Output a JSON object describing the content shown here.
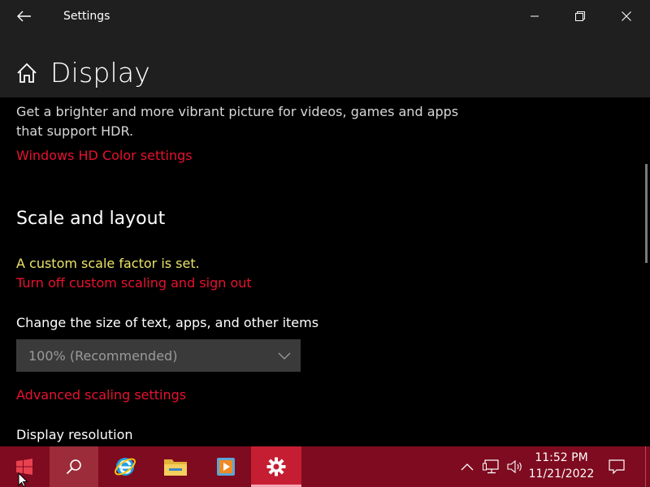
{
  "window": {
    "title": "Settings"
  },
  "page": {
    "title": "Display"
  },
  "hdr": {
    "description": "Get a brighter and more vibrant picture for videos, games and apps that support HDR.",
    "link": "Windows HD Color settings"
  },
  "scale": {
    "section_title": "Scale and layout",
    "warning": "A custom scale factor is set.",
    "signout_link": "Turn off custom scaling and sign out",
    "size_label": "Change the size of text, apps, and other items",
    "size_value": "100% (Recommended)",
    "advanced_link": "Advanced scaling settings",
    "resolution_label": "Display resolution"
  },
  "taskbar": {
    "time": "11:52 PM",
    "date": "11/21/2022",
    "icons": [
      "windows-start-icon",
      "search-icon",
      "internet-explorer-icon",
      "file-explorer-icon",
      "media-player-icon",
      "settings-gear-icon"
    ]
  },
  "colors": {
    "accent_link": "#e81130",
    "warning": "#ece56a",
    "taskbar": "#7e0b1f",
    "titlebar": "#1f1f1f"
  }
}
